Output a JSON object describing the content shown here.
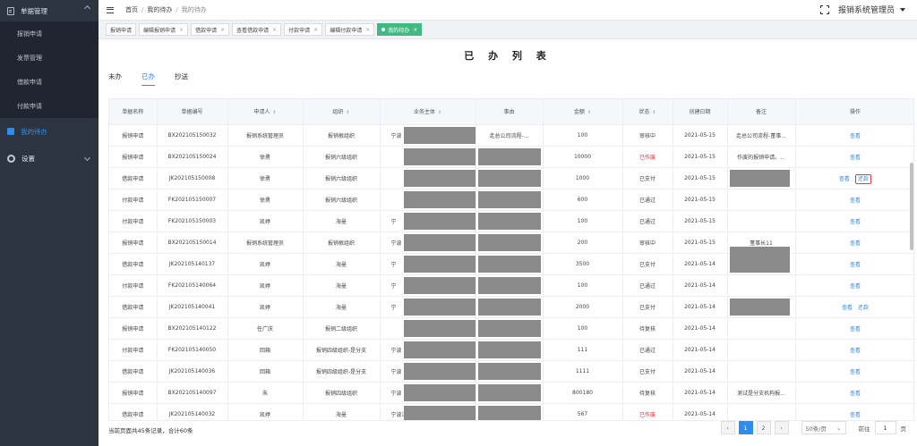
{
  "sidebar": {
    "group": "单据管理",
    "items": [
      "报销申请",
      "发票管理",
      "借款申请",
      "付款申请"
    ],
    "todo": "我的待办",
    "settings": "设置"
  },
  "topbar": {
    "breadcrumb": [
      "首页",
      "我的待办",
      "我的待办"
    ],
    "user": "报销系统管理员"
  },
  "tags": [
    {
      "label": "报销申请",
      "close": false
    },
    {
      "label": "编辑报销申请",
      "close": true
    },
    {
      "label": "借款申请",
      "close": true
    },
    {
      "label": "查看借款申请",
      "close": true
    },
    {
      "label": "付款申请",
      "close": true
    },
    {
      "label": "编辑付款申请",
      "close": true
    },
    {
      "label": "我的待办",
      "close": true,
      "active": true
    }
  ],
  "page": {
    "title": "已 办 列 表",
    "tabs": [
      "未办",
      "已办",
      "抄送"
    ],
    "active_tab": 1
  },
  "table": {
    "headers": [
      "单据名称",
      "单据编号",
      "申请人",
      "组织",
      "业务主体",
      "事由",
      "金额",
      "状态",
      "创建日期",
      "备注",
      "操作"
    ],
    "rows": [
      {
        "name": "报销申请",
        "no": "BX202105150032",
        "applicant": "报销系统管理员",
        "org": "报销根组织",
        "subject": "宁波",
        "reason": "走总公司流程-...",
        "amount": "100",
        "status": "审核中",
        "date": "2021-05-15",
        "note": "走总公司流程-董事...",
        "ops": [
          "查看"
        ]
      },
      {
        "name": "报销申请",
        "no": "BX202105150024",
        "applicant": "徐勇",
        "org": "报销六级组织",
        "subject": "",
        "reason": "",
        "amount": "10000",
        "status": "已作废",
        "date": "2021-05-15",
        "note": "作废的报销申请。...",
        "ops": [
          "查看"
        ]
      },
      {
        "name": "借款申请",
        "no": "JK202105150008",
        "applicant": "徐勇",
        "org": "报销六级组织",
        "subject": "",
        "reason": "",
        "amount": "1000",
        "status": "已支付",
        "date": "2021-05-15",
        "note": "",
        "ops": [
          "查看",
          "还款"
        ]
      },
      {
        "name": "付款申请",
        "no": "FK202105150007",
        "applicant": "徐勇",
        "org": "报销六级组织",
        "subject": "",
        "reason": "",
        "amount": "600",
        "status": "已通过",
        "date": "2021-05-15",
        "note": "",
        "ops": [
          "查看"
        ]
      },
      {
        "name": "付款申请",
        "no": "FK202105150003",
        "applicant": "凯婷",
        "org": "海曼",
        "subject": "宁",
        "reason": "",
        "amount": "100",
        "status": "已通过",
        "date": "2021-05-15",
        "note": "",
        "ops": [
          "查看"
        ]
      },
      {
        "name": "报销申请",
        "no": "BX202105150014",
        "applicant": "报销系统管理员",
        "org": "报销根组织",
        "subject": "宁波",
        "reason": "",
        "amount": "200",
        "status": "审核中",
        "date": "2021-05-15",
        "note": "董事长11",
        "ops": [
          "查看"
        ]
      },
      {
        "name": "借款申请",
        "no": "JK202105140137",
        "applicant": "凯婷",
        "org": "海曼",
        "subject": "宁",
        "reason": "",
        "amount": "3500",
        "status": "已支付",
        "date": "2021-05-14",
        "note": "",
        "ops": [
          "查看"
        ]
      },
      {
        "name": "付款申请",
        "no": "FK202105140064",
        "applicant": "凯婷",
        "org": "海曼",
        "subject": "宁",
        "reason": "",
        "amount": "100",
        "status": "已通过",
        "date": "2021-05-14",
        "note": "",
        "ops": [
          "查看"
        ]
      },
      {
        "name": "借款申请",
        "no": "JK202105140041",
        "applicant": "凯婷",
        "org": "海曼",
        "subject": "宁",
        "reason": "",
        "amount": "2000",
        "status": "已支付",
        "date": "2021-05-14",
        "note": "",
        "ops": [
          "查看",
          "还款"
        ]
      },
      {
        "name": "报销申请",
        "no": "BX202105140122",
        "applicant": "任广庆",
        "org": "报销二级组织",
        "subject": "",
        "reason": "",
        "amount": "100",
        "status": "待复核",
        "date": "2021-05-14",
        "note": "",
        "ops": [
          "查看"
        ]
      },
      {
        "name": "付款申请",
        "no": "FK202105140050",
        "applicant": "回箱",
        "org": "报销四级组织-是分支",
        "subject": "宁波",
        "reason": "",
        "amount": "111",
        "status": "已通过",
        "date": "2021-05-14",
        "note": "",
        "ops": [
          "查看"
        ]
      },
      {
        "name": "借款申请",
        "no": "JK202105140036",
        "applicant": "回箱",
        "org": "报销四级组织-是分支",
        "subject": "宁波",
        "reason": "",
        "amount": "1111",
        "status": "已支付",
        "date": "2021-05-14",
        "note": "",
        "ops": [
          "查看"
        ]
      },
      {
        "name": "报销申请",
        "no": "BX202105140097",
        "applicant": "朱",
        "org": "报销四级组织",
        "subject": "宁波",
        "reason": "",
        "amount": "800180",
        "status": "待复核",
        "date": "2021-05-14",
        "note": "测试是分支机构报...",
        "ops": [
          "查看"
        ]
      },
      {
        "name": "借款申请",
        "no": "JK202105140032",
        "applicant": "凯婷",
        "org": "海曼",
        "subject": "宁波江",
        "reason": "",
        "amount": "567",
        "status": "已作废",
        "date": "2021-05-14",
        "note": "",
        "ops": [
          "查看"
        ]
      }
    ]
  },
  "footer": {
    "summary": "当前页面共45条记录，合计60条"
  },
  "pager": {
    "pages": [
      "1",
      "2"
    ],
    "current": "1",
    "page_size": "50条/页",
    "goto_label": "前往",
    "goto_value": "1",
    "goto_suffix": "页"
  }
}
